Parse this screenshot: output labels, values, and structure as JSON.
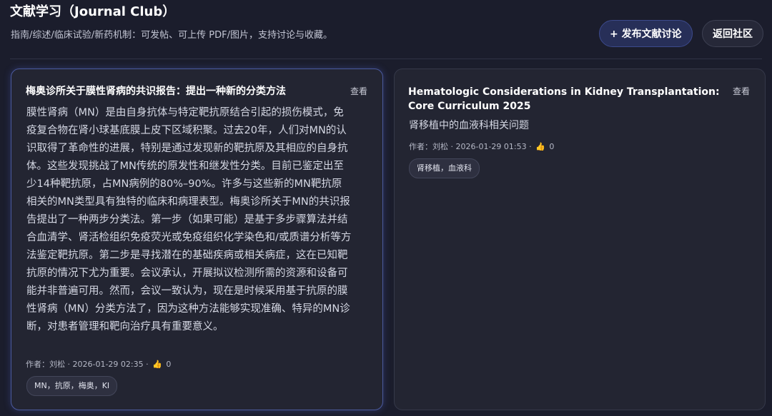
{
  "header": {
    "title": "文献学习（Journal Club）",
    "subtitle": "指南/综述/临床试验/新药机制：可发帖、可上传 PDF/图片，支持讨论与收藏。",
    "new_post_label": "+ 发布文献讨论",
    "back_label": "返回社区"
  },
  "posts": [
    {
      "title": "梅奥诊所关于膜性肾病的共识报告：提出一种新的分类方法",
      "view_label": "查看",
      "body": "膜性肾病（MN）是由自身抗体与特定靶抗原结合引起的损伤模式，免疫复合物在肾小球基底膜上皮下区域积聚。过去20年，人们对MN的认识取得了革命性的进展，特别是通过发现新的靶抗原及其相应的自身抗体。这些发现挑战了MN传统的原发性和继发性分类。目前已鉴定出至少14种靶抗原，占MN病例的80%–90%。许多与这些新的MN靶抗原相关的MN类型具有独特的临床和病理表型。梅奥诊所关于MN的共识报告提出了一种两步分类法。第一步（如果可能）是基于多步骤算法并结合血清学、肾活检组织免疫荧光或免疫组织化学染色和/或质谱分析等方法鉴定靶抗原。第二步是寻找潜在的基础疾病或相关病症，这在已知靶抗原的情况下尤为重要。会议承认，开展拟议检测所需的资源和设备可能并非普遍可用。然而，会议一致认为，现在是时候采用基于抗原的膜性肾病（MN）分类方法了，因为这种方法能够实现准确、特异的MN诊断，对患者管理和靶向治疗具有重要意义。",
      "meta": "作者：刘松 · 2026-01-29 02:35 ·",
      "likes": "0",
      "tag": "MN，抗原，梅奥，KI"
    },
    {
      "title": "Hematologic Considerations in Kidney Transplantation: Core Curriculum 2025",
      "view_label": "查看",
      "description": "肾移植中的血液科相关问题",
      "meta": "作者：刘松 · 2026-01-29 01:53 ·",
      "likes": "0",
      "tag": "肾移植，血液科"
    }
  ],
  "icons": {
    "like": "thumbs-up-icon"
  },
  "colors": {
    "background": "#1b1d2c",
    "card": "#232532",
    "accent_border": "#4b5a9e",
    "primary_button": "#272f58"
  }
}
